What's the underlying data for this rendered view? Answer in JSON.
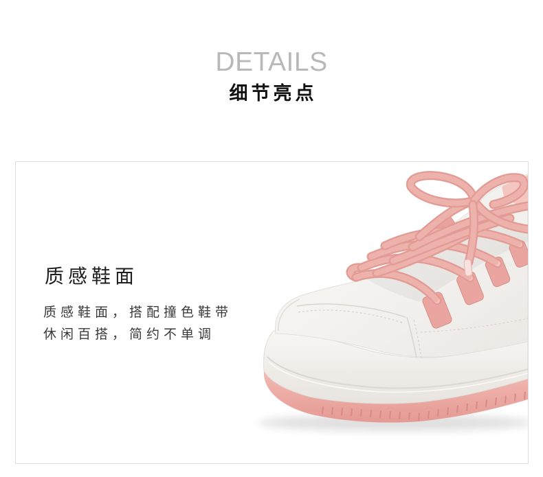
{
  "header": {
    "title_en": "DETAILS",
    "title_cn": "细节亮点"
  },
  "feature": {
    "title": "质感鞋面",
    "desc_lines": [
      "质感鞋面，搭配撞色鞋带",
      "休闲百搭，简约不单调"
    ]
  },
  "colors": {
    "title_en": "#b8b8b8",
    "title_cn": "#111111",
    "body_text": "#3a3a3a",
    "frame_border": "#dcdcdc",
    "lace_pink": "#f5c3bc",
    "sole_pink": "#eea7a1",
    "upper_white": "#f7f6f3"
  }
}
